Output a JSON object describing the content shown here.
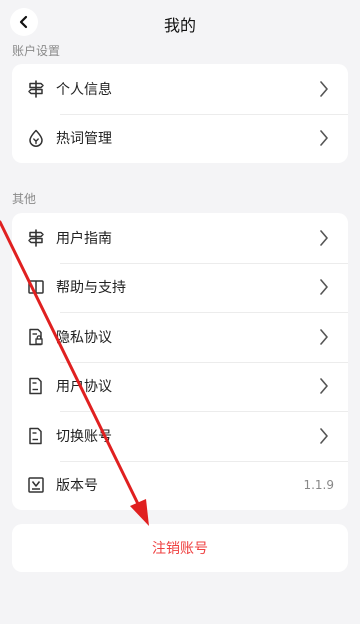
{
  "header": {
    "title": "我的",
    "back_icon": "chevron-left-icon"
  },
  "sections": [
    {
      "label": "账户设置",
      "items": [
        {
          "name": "personal-info",
          "label": "个人信息",
          "icon": "signpost-icon"
        },
        {
          "name": "hot-words",
          "label": "热词管理",
          "icon": "drop-icon"
        }
      ]
    },
    {
      "label": "其他",
      "items": [
        {
          "name": "user-guide",
          "label": "用户指南",
          "icon": "signpost-icon"
        },
        {
          "name": "help-support",
          "label": "帮助与支持",
          "icon": "book-icon"
        },
        {
          "name": "privacy-policy",
          "label": "隐私协议",
          "icon": "document-lock-icon"
        },
        {
          "name": "user-agreement",
          "label": "用户协议",
          "icon": "document-icon"
        },
        {
          "name": "switch-account",
          "label": "切换账号",
          "icon": "document-icon"
        },
        {
          "name": "version",
          "label": "版本号",
          "icon": "version-icon",
          "value": "1.1.9"
        }
      ]
    }
  ],
  "logout": {
    "label": "注销账号",
    "color": "#ef4040"
  },
  "annotation": {
    "type": "red-arrow",
    "color": "#e02020"
  }
}
